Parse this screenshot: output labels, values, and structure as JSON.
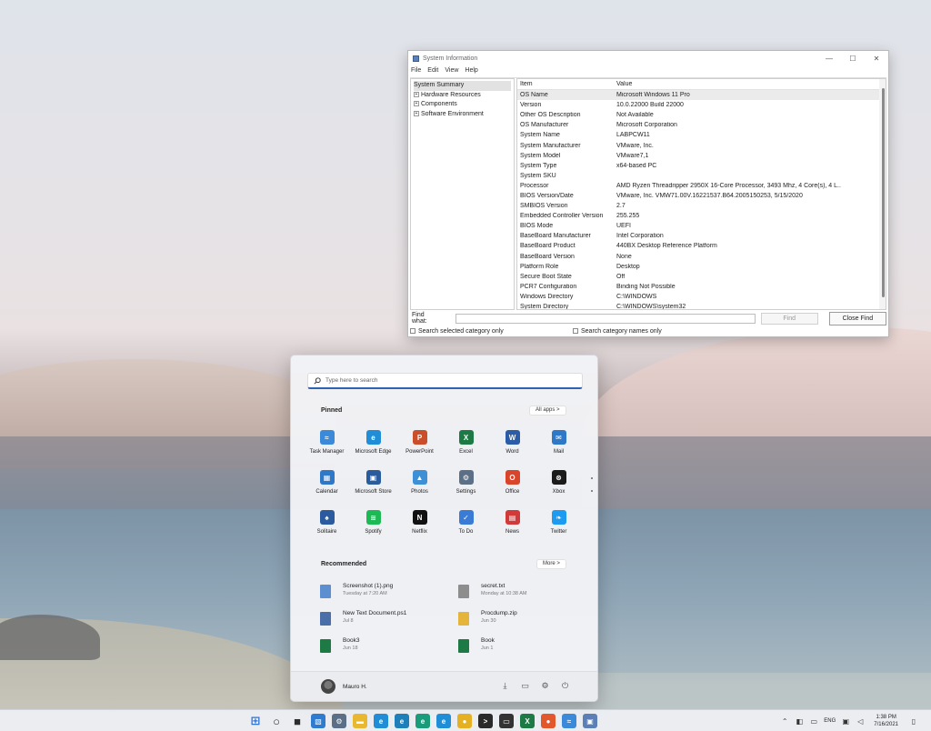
{
  "sysinfo": {
    "title": "System Information",
    "controls": [
      "—",
      "☐",
      "✕"
    ],
    "menu": [
      "File",
      "Edit",
      "View",
      "Help"
    ],
    "tree": [
      "System Summary",
      "Hardware Resources",
      "Components",
      "Software Environment"
    ],
    "columns": {
      "item": "Item",
      "value": "Value"
    },
    "rows": [
      {
        "item": "OS Name",
        "value": "Microsoft Windows 11 Pro"
      },
      {
        "item": "Version",
        "value": "10.0.22000 Build 22000"
      },
      {
        "item": "Other OS Description",
        "value": "Not Available"
      },
      {
        "item": "OS Manufacturer",
        "value": "Microsoft Corporation"
      },
      {
        "item": "System Name",
        "value": "LABPCW11"
      },
      {
        "item": "System Manufacturer",
        "value": "VMware, Inc."
      },
      {
        "item": "System Model",
        "value": "VMware7,1"
      },
      {
        "item": "System Type",
        "value": "x64-based PC"
      },
      {
        "item": "System SKU",
        "value": ""
      },
      {
        "item": "Processor",
        "value": "AMD Ryzen Threadripper 2950X 16-Core Processor, 3493 Mhz, 4 Core(s), 4 L..."
      },
      {
        "item": "BIOS Version/Date",
        "value": "VMware, Inc. VMW71.00V.16221537.B64.2005150253, 5/15/2020"
      },
      {
        "item": "SMBIOS Version",
        "value": "2.7"
      },
      {
        "item": "Embedded Controller Version",
        "value": "255.255"
      },
      {
        "item": "BIOS Mode",
        "value": "UEFI"
      },
      {
        "item": "BaseBoard Manufacturer",
        "value": "Intel Corporation"
      },
      {
        "item": "BaseBoard Product",
        "value": "440BX Desktop Reference Platform"
      },
      {
        "item": "BaseBoard Version",
        "value": "None"
      },
      {
        "item": "Platform Role",
        "value": "Desktop"
      },
      {
        "item": "Secure Boot State",
        "value": "Off"
      },
      {
        "item": "PCR7 Configuration",
        "value": "Binding Not Possible"
      },
      {
        "item": "Windows Directory",
        "value": "C:\\WINDOWS"
      },
      {
        "item": "System Directory",
        "value": "C:\\WINDOWS\\system32"
      }
    ],
    "find_label": "Find what:",
    "find_value": "",
    "find_button": "Find",
    "close_find_button": "Close Find",
    "search_selected": "Search selected category only",
    "search_names": "Search category names only"
  },
  "start": {
    "search_placeholder": "Type here to search",
    "pinned_title": "Pinned",
    "all_apps": "All apps  >",
    "pinned": [
      {
        "label": "Task Manager",
        "icon": "task-manager-icon",
        "color": "#3b8ad9",
        "glyph": "≈"
      },
      {
        "label": "Microsoft Edge",
        "icon": "edge-icon",
        "color": "#1f8ed6",
        "glyph": "e"
      },
      {
        "label": "PowerPoint",
        "icon": "powerpoint-icon",
        "color": "#c94f2c",
        "glyph": "P"
      },
      {
        "label": "Excel",
        "icon": "excel-icon",
        "color": "#1d7a45",
        "glyph": "X"
      },
      {
        "label": "Word",
        "icon": "word-icon",
        "color": "#2b5ca8",
        "glyph": "W"
      },
      {
        "label": "Mail",
        "icon": "mail-icon",
        "color": "#2f78c8",
        "glyph": "✉"
      },
      {
        "label": "Calendar",
        "icon": "calendar-icon",
        "color": "#2f78c8",
        "glyph": "▦"
      },
      {
        "label": "Microsoft Store",
        "icon": "store-icon",
        "color": "#2a5b9c",
        "glyph": "▣"
      },
      {
        "label": "Photos",
        "icon": "photos-icon",
        "color": "#3d8fd6",
        "glyph": "▲"
      },
      {
        "label": "Settings",
        "icon": "settings-icon",
        "color": "#5b6f87",
        "glyph": "⚙"
      },
      {
        "label": "Office",
        "icon": "office-icon",
        "color": "#d9452b",
        "glyph": "O"
      },
      {
        "label": "Xbox",
        "icon": "xbox-icon",
        "color": "#1b1b1b",
        "glyph": "⊗"
      },
      {
        "label": "Solitaire",
        "icon": "solitaire-icon",
        "color": "#2c5a9e",
        "glyph": "♠"
      },
      {
        "label": "Spotify",
        "icon": "spotify-icon",
        "color": "#1db954",
        "glyph": "≋"
      },
      {
        "label": "Netflix",
        "icon": "netflix-icon",
        "color": "#111111",
        "glyph": "N"
      },
      {
        "label": "To Do",
        "icon": "todo-icon",
        "color": "#3a7bd5",
        "glyph": "✓"
      },
      {
        "label": "News",
        "icon": "news-icon",
        "color": "#d23a3a",
        "glyph": "▤"
      },
      {
        "label": "Twitter",
        "icon": "twitter-icon",
        "color": "#1d9bf0",
        "glyph": "❧"
      }
    ],
    "recommended_title": "Recommended",
    "more": "More  >",
    "recommended": [
      {
        "name": "Screenshot (1).png",
        "time": "Tuesday at 7:20 AM",
        "icon": "image-file-icon",
        "color": "#5c8fd0"
      },
      {
        "name": "secret.txt",
        "time": "Monday at 10:38 AM",
        "icon": "text-file-icon",
        "color": "#8d8d8d"
      },
      {
        "name": "New Text Document.ps1",
        "time": "Jul 8",
        "icon": "script-file-icon",
        "color": "#4a6fa8"
      },
      {
        "name": "Procdump.zip",
        "time": "Jun 30",
        "icon": "zip-file-icon",
        "color": "#e4b53a"
      },
      {
        "name": "Book3",
        "time": "Jun 18",
        "icon": "excel-file-icon",
        "color": "#1d7a45"
      },
      {
        "name": "Book",
        "time": "Jun 1",
        "icon": "excel-file-icon",
        "color": "#1d7a45"
      }
    ],
    "user_name": "Mauro H."
  },
  "taskbar": {
    "apps": [
      {
        "icon": "start-icon",
        "color": "#2b73d4",
        "glyph": "⊞"
      },
      {
        "icon": "search-icon",
        "color": "#2c2c2c",
        "glyph": "○"
      },
      {
        "icon": "task-view-icon",
        "color": "#2c2c2c",
        "glyph": "■"
      },
      {
        "icon": "widgets-icon",
        "color": "#2f7bd0",
        "glyph": "▧"
      },
      {
        "icon": "settings-icon",
        "color": "#5b6f87",
        "glyph": "⚙"
      },
      {
        "icon": "file-explorer-icon",
        "color": "#e8b930",
        "glyph": "▬"
      },
      {
        "icon": "edge-icon",
        "color": "#1f8ed6",
        "glyph": "e"
      },
      {
        "icon": "edge-beta-icon",
        "color": "#1f7fb8",
        "glyph": "e"
      },
      {
        "icon": "edge-dev-icon",
        "color": "#1a9b7a",
        "glyph": "e"
      },
      {
        "icon": "edge-canary-icon",
        "color": "#1f8ed6",
        "glyph": "e"
      },
      {
        "icon": "chrome-icon",
        "color": "#e5b022",
        "glyph": "●"
      },
      {
        "icon": "terminal-icon",
        "color": "#2a2a2a",
        "glyph": ">"
      },
      {
        "icon": "console-icon",
        "color": "#333333",
        "glyph": "▭"
      },
      {
        "icon": "excel-icon",
        "color": "#1d7a45",
        "glyph": "X"
      },
      {
        "icon": "firefox-icon",
        "color": "#e2572b",
        "glyph": "●"
      },
      {
        "icon": "task-manager-icon",
        "color": "#3b8ad9",
        "glyph": "≈"
      },
      {
        "icon": "system-info-icon",
        "color": "#5b7fb6",
        "glyph": "▣"
      }
    ],
    "tray_lang": "ENG",
    "time": "1:38 PM",
    "date": "7/16/2021"
  }
}
